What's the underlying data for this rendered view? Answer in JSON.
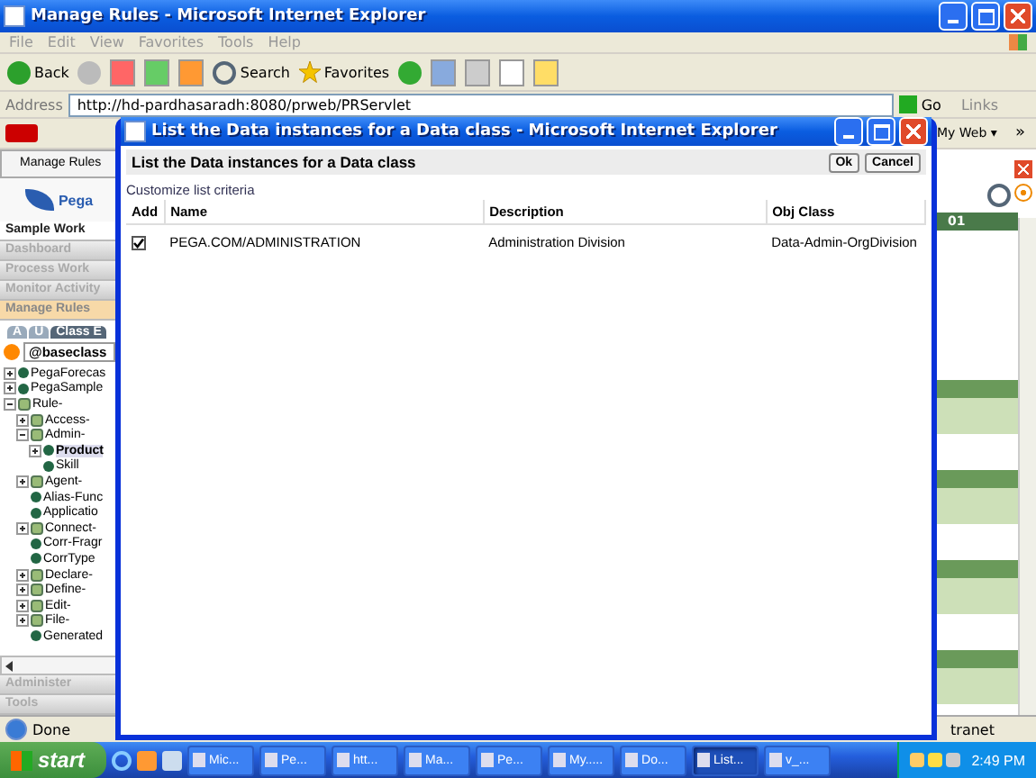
{
  "main_window": {
    "title": "Manage Rules - Microsoft Internet Explorer",
    "menu": [
      "File",
      "Edit",
      "View",
      "Favorites",
      "Tools",
      "Help"
    ],
    "toolbar": {
      "back": "Back",
      "search": "Search",
      "favorites": "Favorites"
    },
    "address_label": "Address",
    "address": "http://hd-pardhasaradh:8080/prweb/PRServlet",
    "go": "Go",
    "links": "Links",
    "my_web": "My Web ▾",
    "chevron": "»"
  },
  "left_panel": {
    "tab": "Manage Rules",
    "logo": "Pega",
    "nav": [
      {
        "label": "Sample Work",
        "kind": "title",
        "selected": false
      },
      {
        "label": "Dashboard",
        "kind": "item",
        "selected": false
      },
      {
        "label": "Process Work",
        "kind": "item",
        "selected": false
      },
      {
        "label": "Monitor Activity",
        "kind": "item",
        "selected": false
      },
      {
        "label": "Manage Rules",
        "kind": "item",
        "selected": true
      }
    ],
    "class_tabs": [
      {
        "label": "A",
        "selected": false
      },
      {
        "label": "U",
        "selected": false
      },
      {
        "label": "Class E",
        "selected": true
      }
    ],
    "class_field": "@baseclass",
    "tree": [
      {
        "label": "PegaForecas",
        "kind": "instance",
        "expanded": false,
        "selected": false
      },
      {
        "label": "PegaSample",
        "kind": "instance",
        "expanded": false,
        "selected": false
      },
      {
        "label": "Rule-",
        "kind": "class",
        "expanded": true,
        "selected": false,
        "children": [
          {
            "label": "Access-",
            "kind": "class",
            "expanded": false,
            "selected": false
          },
          {
            "label": "Admin-",
            "kind": "class",
            "expanded": true,
            "selected": false,
            "children": [
              {
                "label": "Product",
                "kind": "instance",
                "expanded": false,
                "selected": true
              },
              {
                "label": "Skill",
                "kind": "instance",
                "selected": false
              }
            ]
          },
          {
            "label": "Agent-",
            "kind": "class",
            "expanded": false,
            "selected": false
          },
          {
            "label": "Alias-Func",
            "kind": "instance",
            "selected": false
          },
          {
            "label": "Applicatio",
            "kind": "instance",
            "selected": false
          },
          {
            "label": "Connect-",
            "kind": "class",
            "expanded": false,
            "selected": false
          },
          {
            "label": "Corr-Fragr",
            "kind": "instance",
            "selected": false
          },
          {
            "label": "CorrType",
            "kind": "instance",
            "selected": false
          },
          {
            "label": "Declare-",
            "kind": "class",
            "expanded": false,
            "selected": false
          },
          {
            "label": "Define-",
            "kind": "class",
            "expanded": false,
            "selected": false
          },
          {
            "label": "Edit-",
            "kind": "class",
            "expanded": false,
            "selected": false
          },
          {
            "label": "File-",
            "kind": "class",
            "expanded": false,
            "selected": false
          },
          {
            "label": "Generated",
            "kind": "instance",
            "selected": false
          }
        ]
      }
    ],
    "bottom_nav": [
      "Administer",
      "Tools"
    ]
  },
  "right_panel": {
    "header": "01"
  },
  "status_bar": {
    "text": "Done",
    "zone": "tranet"
  },
  "popup": {
    "title": "List the Data instances for a Data class - Microsoft Internet Explorer",
    "heading": "List the Data instances for a Data class",
    "ok": "Ok",
    "cancel": "Cancel",
    "link": "Customize list criteria",
    "columns": [
      "Add",
      "Name",
      "Description",
      "Obj Class"
    ],
    "rows": [
      {
        "checked": true,
        "name": "PEGA.COM/ADMINISTRATION",
        "description": "Administration Division",
        "obj_class": "Data-Admin-OrgDivision"
      }
    ]
  },
  "taskbar": {
    "start": "start",
    "tasks": [
      {
        "label": "Mic...",
        "selected": false
      },
      {
        "label": "Pe...",
        "selected": false
      },
      {
        "label": "htt...",
        "selected": false
      },
      {
        "label": "Ma...",
        "selected": false
      },
      {
        "label": "Pe...",
        "selected": false
      },
      {
        "label": "My.....",
        "selected": false
      },
      {
        "label": "Do...",
        "selected": false
      },
      {
        "label": "List...",
        "selected": true
      },
      {
        "label": "v_...",
        "selected": false
      }
    ],
    "clock": "2:49 PM"
  }
}
